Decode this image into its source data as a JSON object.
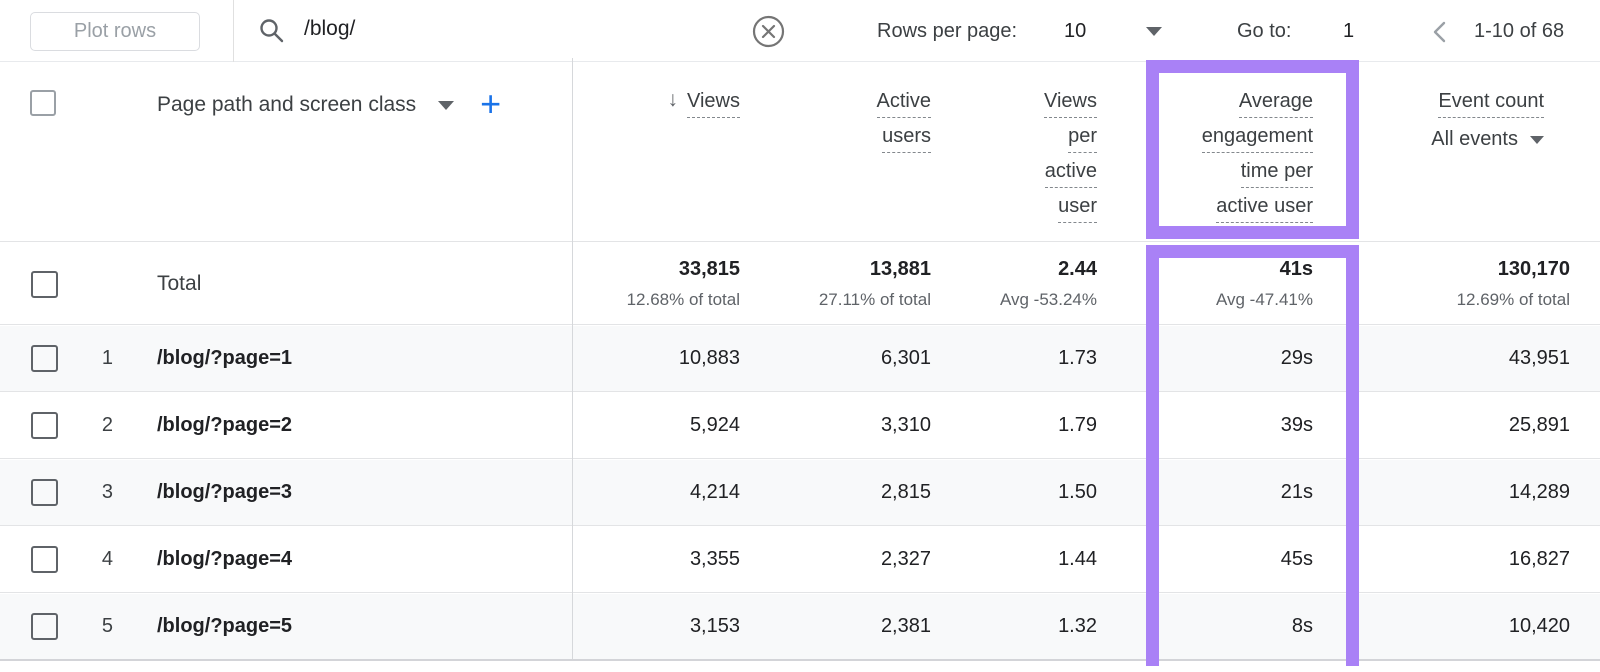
{
  "topbar": {
    "plot_rows_label": "Plot rows",
    "search_value": "/blog/",
    "rows_per_page_label": "Rows per page:",
    "rows_per_page_value": "10",
    "goto_label": "Go to:",
    "goto_value": "1",
    "pagination_range": "1-10 of 68"
  },
  "icons": {
    "sort_descending": "↓",
    "add": "+"
  },
  "colors": {
    "accent_blue": "#1a73e8",
    "annotation_purple": "#a981f6"
  },
  "table": {
    "dimension_header": "Page path and screen class",
    "columns": {
      "views": {
        "lines": [
          "Views"
        ],
        "sorted": "descending"
      },
      "active_users": {
        "lines": [
          "Active",
          "users"
        ]
      },
      "views_per_active_user": {
        "lines": [
          "Views",
          "per",
          "active",
          "user"
        ]
      },
      "avg_engagement_time": {
        "lines": [
          "Average",
          "engagement",
          "time per",
          "active user"
        ],
        "highlighted": true
      },
      "event_count": {
        "title": "Event count",
        "filter": "All events"
      }
    },
    "total_row": {
      "label": "Total",
      "views": "33,815",
      "views_pct": "12.68% of total",
      "active_users": "13,881",
      "active_users_pct": "27.11% of total",
      "views_per_active_user": "2.44",
      "views_per_active_user_pct": "Avg -53.24%",
      "avg_engagement_time": "41s",
      "avg_engagement_time_pct": "Avg -47.41%",
      "event_count": "130,170",
      "event_count_pct": "12.69% of total"
    },
    "rows": [
      {
        "num": "1",
        "path": "/blog/?page=1",
        "views": "10,883",
        "active_users": "6,301",
        "views_per_active_user": "1.73",
        "avg_engagement_time": "29s",
        "event_count": "43,951"
      },
      {
        "num": "2",
        "path": "/blog/?page=2",
        "views": "5,924",
        "active_users": "3,310",
        "views_per_active_user": "1.79",
        "avg_engagement_time": "39s",
        "event_count": "25,891"
      },
      {
        "num": "3",
        "path": "/blog/?page=3",
        "views": "4,214",
        "active_users": "2,815",
        "views_per_active_user": "1.50",
        "avg_engagement_time": "21s",
        "event_count": "14,289"
      },
      {
        "num": "4",
        "path": "/blog/?page=4",
        "views": "3,355",
        "active_users": "2,327",
        "views_per_active_user": "1.44",
        "avg_engagement_time": "45s",
        "event_count": "16,827"
      },
      {
        "num": "5",
        "path": "/blog/?page=5",
        "views": "3,153",
        "active_users": "2,381",
        "views_per_active_user": "1.32",
        "avg_engagement_time": "8s",
        "event_count": "10,420"
      }
    ]
  }
}
